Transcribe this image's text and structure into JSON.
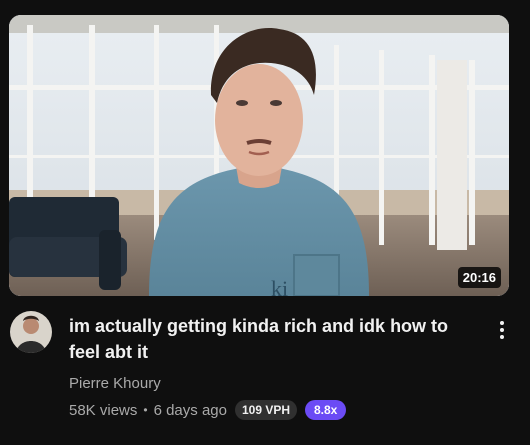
{
  "video": {
    "duration": "20:16",
    "title": "im actually getting kinda rich and idk how to feel abt it",
    "channel": "Pierre Khoury",
    "views": "58K views",
    "separator": "•",
    "age": "6 days ago",
    "vph_badge": "109 VPH",
    "multiplier_badge": "8.8x"
  },
  "colors": {
    "background": "#0f0f0f",
    "title": "#f1f1f1",
    "secondary_text": "#aaaaaa",
    "vph_badge_bg": "#303030",
    "multiplier_badge_bg": "#6b4bf5"
  },
  "icons": {
    "menu": "more-vertical-icon"
  }
}
